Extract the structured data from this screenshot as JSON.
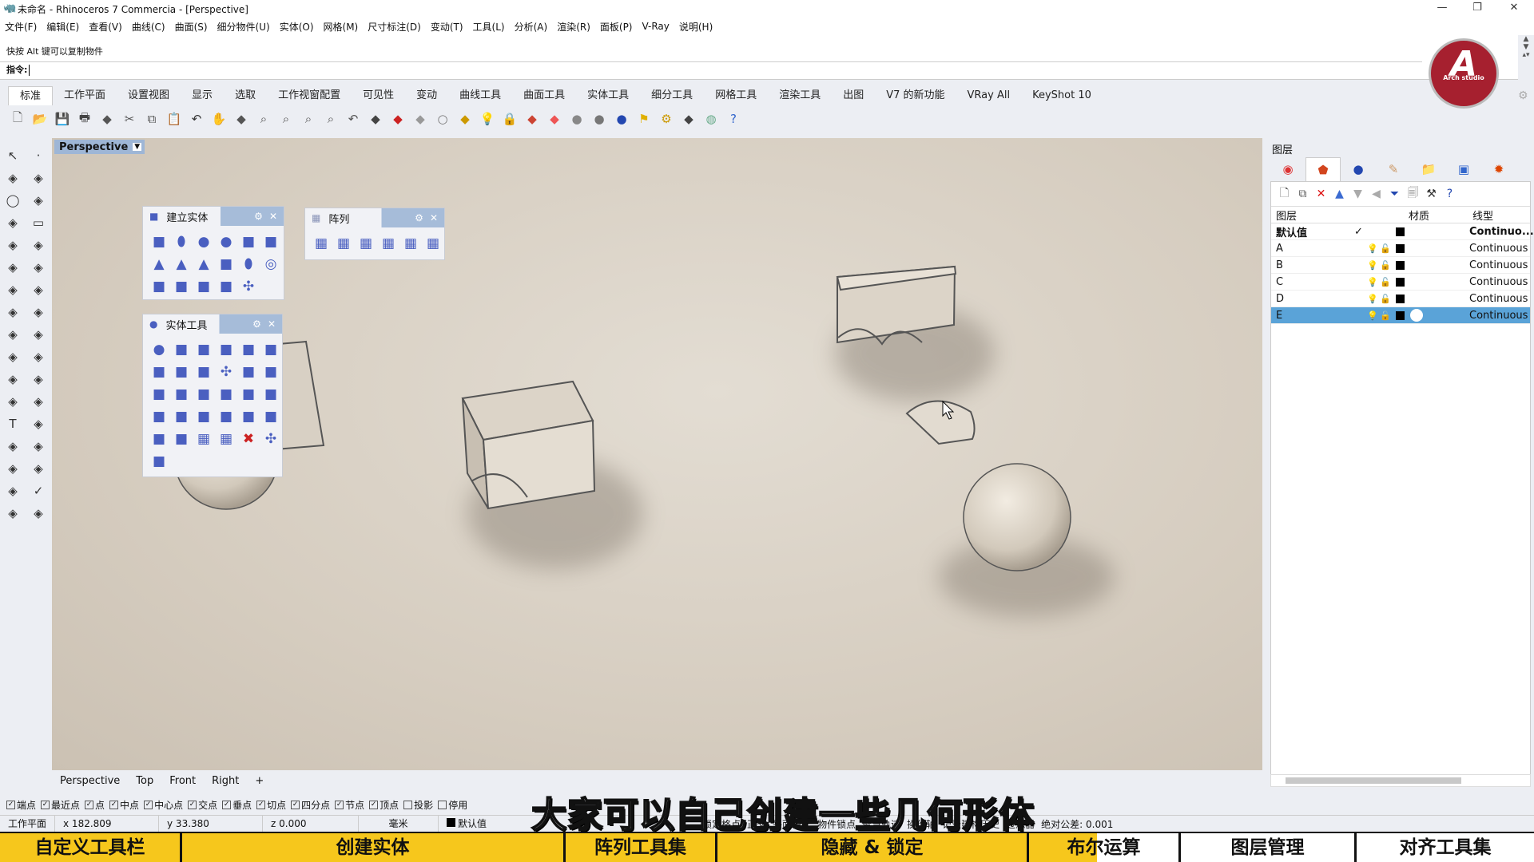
{
  "window": {
    "title": "未命名 - Rhinoceros 7 Commercia - [Perspective]"
  },
  "menu": [
    "文件(F)",
    "编辑(E)",
    "查看(V)",
    "曲线(C)",
    "曲面(S)",
    "细分物件(U)",
    "实体(O)",
    "网格(M)",
    "尺寸标注(D)",
    "变动(T)",
    "工具(L)",
    "分析(A)",
    "渲染(R)",
    "面板(P)",
    "V-Ray",
    "说明(H)"
  ],
  "command": {
    "history_line": "快按 Alt 键可以复制物件",
    "prompt": "指令:",
    "value": ""
  },
  "logo": {
    "text": "Arch studio",
    "color": "#a6202f"
  },
  "tabs": [
    {
      "label": "标准",
      "active": true
    },
    {
      "label": "工作平面"
    },
    {
      "label": "设置视图"
    },
    {
      "label": "显示"
    },
    {
      "label": "选取"
    },
    {
      "label": "工作视窗配置"
    },
    {
      "label": "可见性"
    },
    {
      "label": "变动"
    },
    {
      "label": "曲线工具"
    },
    {
      "label": "曲面工具"
    },
    {
      "label": "实体工具"
    },
    {
      "label": "细分工具"
    },
    {
      "label": "网格工具"
    },
    {
      "label": "渲染工具"
    },
    {
      "label": "出图"
    },
    {
      "label": "V7 的新功能"
    },
    {
      "label": "VRay All"
    },
    {
      "label": "KeyShot 10"
    }
  ],
  "toolbar_icons": [
    "new-icon",
    "open-icon",
    "save-icon",
    "print-icon",
    "import-icon",
    "cut-icon",
    "copy-icon",
    "paste-icon",
    "undo-icon",
    "pan-icon",
    "rotate-view-icon",
    "zoom-icon",
    "zoom-window-icon",
    "zoom-extents-icon",
    "zoom-selected-icon",
    "undo-view-icon",
    "four-viewports-icon",
    "car-icon",
    "hide-icon",
    "circle-icon",
    "points-icon",
    "light-icon",
    "lock-icon",
    "shield-icon",
    "color-wheel-icon",
    "sphere-render-icon",
    "sphere-grey-icon",
    "sphere-blue-icon",
    "flag-icon",
    "gear-icon",
    "dimension-icon",
    "globe-icon",
    "help-icon"
  ],
  "left_tools": [
    "select",
    "point",
    "polyline",
    "curve",
    "circle",
    "arc",
    "polygon",
    "rectangle",
    "ellipse",
    "fillet",
    "surface",
    "revolve",
    "box",
    "boolean",
    "extrude",
    "pipe",
    "explode",
    "trim",
    "split",
    "join",
    "group",
    "array",
    "move",
    "rotate",
    "text",
    "snap",
    "mirror",
    "scale",
    "grid",
    "align",
    "dimension",
    "check",
    "solid",
    "light"
  ],
  "viewport": {
    "label": "Perspective",
    "bg": "#d8d0c4"
  },
  "panels": {
    "create_solid": {
      "title": "建立实体",
      "icons": [
        "box",
        "cylinder",
        "sphere",
        "sphere-points",
        "ellipsoid",
        "paraboloid",
        "cone",
        "truncated-cone",
        "pyramid",
        "slab",
        "tube",
        "torus",
        "pipe",
        "pipe-variable",
        "extrude",
        "extrude-surface",
        "puzzle"
      ]
    },
    "array": {
      "title": "阵列",
      "icons": [
        "rect-array",
        "polar-array",
        "curve-array",
        "grid-array",
        "surface-curve-array",
        "linear-array"
      ]
    },
    "solid_tools": {
      "title": "实体工具",
      "icons": [
        "union",
        "difference",
        "intersection",
        "split",
        "create-solid",
        "shell",
        "extract-surface",
        "offset",
        "cap",
        "puzzle",
        "edit",
        "fillet",
        "chamfer",
        "blend",
        "move-face",
        "move-edge",
        "move-untrimmed",
        "extrude-face",
        "gumball",
        "split-face",
        "rotate-face",
        "hole",
        "round-hole",
        "move-hole",
        "drill",
        "drill-place",
        "hole-array",
        "hole-array-polar",
        "delete-hole",
        "puzzle-2",
        "bucket"
      ]
    }
  },
  "viewport_tabs": [
    "Perspective",
    "Top",
    "Front",
    "Right",
    "+"
  ],
  "osnaps": [
    {
      "label": "端点",
      "checked": true
    },
    {
      "label": "最近点",
      "checked": true
    },
    {
      "label": "点",
      "checked": true
    },
    {
      "label": "中点",
      "checked": true
    },
    {
      "label": "中心点",
      "checked": true
    },
    {
      "label": "交点",
      "checked": true
    },
    {
      "label": "垂点",
      "checked": true
    },
    {
      "label": "切点",
      "checked": true
    },
    {
      "label": "四分点",
      "checked": true
    },
    {
      "label": "节点",
      "checked": true
    },
    {
      "label": "顶点",
      "checked": true
    },
    {
      "label": "投影",
      "checked": false
    },
    {
      "label": "停用",
      "checked": false
    }
  ],
  "status": {
    "plane": "工作平面",
    "x": "x 182.809",
    "y": "y 33.380",
    "z": "z 0.000",
    "unit": "毫米",
    "layer": "默认值",
    "toggles": [
      "锁定格点",
      "正交",
      "平面模式",
      "物件锁点",
      "智慧轨迹",
      "操作轴",
      "记录建构历史",
      "过滤器",
      "绝对公差: 0.001"
    ]
  },
  "subtitle": "大家可以自己创建一些几何形体",
  "chapters": {
    "progress": 0.715,
    "items": [
      "自定义工具栏",
      "创建实体",
      "阵列工具集",
      "隐藏 & 锁定",
      "布尔运算",
      "图层管理",
      "对齐工具集"
    ],
    "color": "#f6c71c"
  },
  "layers_panel": {
    "title": "图层",
    "tab_icons": [
      "color-wheel-icon",
      "layers-icon",
      "materials-icon",
      "render-icon",
      "folder-icon",
      "help-panel-icon",
      "sun-icon"
    ],
    "tool_icons": [
      "new-layer-icon",
      "new-sublayer-icon",
      "delete-icon",
      "move-up-icon",
      "move-down-icon",
      "move-parent-icon",
      "filter-icon",
      "copy-icon",
      "tools-icon",
      "help-icon"
    ],
    "columns": {
      "name": "图层",
      "material": "材质",
      "linetype": "线型"
    },
    "rows": [
      {
        "name": "默认值",
        "current": true,
        "linetype": "Continuo...",
        "color": "#000000"
      },
      {
        "name": "A",
        "linetype": "Continuous",
        "color": "#000000"
      },
      {
        "name": "B",
        "linetype": "Continuous",
        "color": "#000000"
      },
      {
        "name": "C",
        "linetype": "Continuous",
        "color": "#000000"
      },
      {
        "name": "D",
        "linetype": "Continuous",
        "color": "#000000"
      },
      {
        "name": "E",
        "linetype": "Continuous",
        "color": "#000000",
        "selected": true
      }
    ]
  }
}
